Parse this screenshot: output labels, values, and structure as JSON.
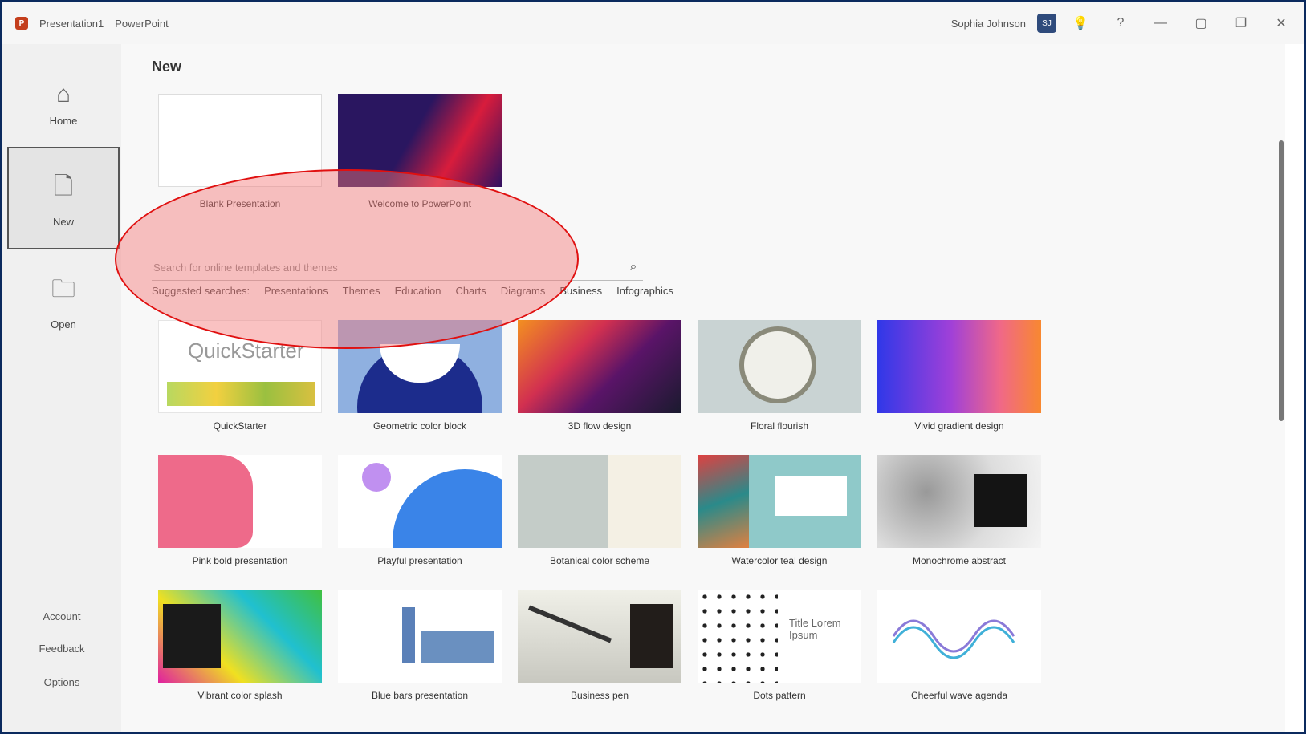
{
  "titlebar": {
    "app_name": "Presentation1",
    "status": "PowerPoint",
    "user": "Sophia Johnson",
    "avatar_initials": "SJ"
  },
  "sidebar": {
    "items": [
      {
        "label": "Home",
        "icon": "home-icon"
      },
      {
        "label": "New",
        "icon": "new-file-icon"
      },
      {
        "label": "Open",
        "icon": "folder-icon"
      }
    ],
    "bottom": [
      "Account",
      "Feedback",
      "Options"
    ]
  },
  "main": {
    "title": "New",
    "top_tiles": [
      {
        "label": "Blank Presentation"
      },
      {
        "label": "Welcome to PowerPoint"
      }
    ],
    "search_placeholder": "Search for online templates and themes",
    "categories": [
      "Suggested searches:",
      "Presentations",
      "Themes",
      "Education",
      "Charts",
      "Diagrams",
      "Business",
      "Infographics"
    ],
    "templates": [
      {
        "label": "QuickStarter",
        "thumb_text": "QuickStarter"
      },
      {
        "label": "Geometric color block"
      },
      {
        "label": "3D flow design"
      },
      {
        "label": "Floral flourish"
      },
      {
        "label": "Vivid gradient design"
      },
      {
        "label": "Pink bold presentation"
      },
      {
        "label": "Playful presentation"
      },
      {
        "label": "Botanical color scheme"
      },
      {
        "label": "Watercolor teal design"
      },
      {
        "label": "Monochrome abstract"
      },
      {
        "label": "Vibrant color splash"
      },
      {
        "label": "Blue bars presentation"
      },
      {
        "label": "Business pen"
      },
      {
        "label": "Dots pattern",
        "thumb_text": "Title Lorem Ipsum"
      },
      {
        "label": "Cheerful wave agenda"
      }
    ]
  },
  "colors": {
    "accent": "#c43e1c",
    "annotation": "#e01010",
    "frame": "#0b2a5e"
  }
}
